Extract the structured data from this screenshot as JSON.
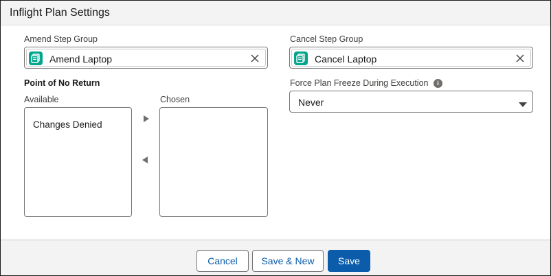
{
  "header": {
    "title": "Inflight Plan Settings"
  },
  "amend": {
    "label": "Amend Step Group",
    "value": "Amend Laptop",
    "icon": "step-group-icon",
    "clear_icon": "close-icon"
  },
  "cancel": {
    "label": "Cancel Step Group",
    "value": "Cancel Laptop",
    "icon": "step-group-icon",
    "clear_icon": "close-icon"
  },
  "point_of_no_return": {
    "title": "Point of No Return",
    "available_label": "Available",
    "chosen_label": "Chosen",
    "available_items": [
      "Changes Denied"
    ],
    "chosen_items": []
  },
  "freeze": {
    "label": "Force Plan Freeze During Execution",
    "info_icon": "info-icon",
    "value": "Never"
  },
  "footer": {
    "cancel_label": "Cancel",
    "save_new_label": "Save & New",
    "save_label": "Save"
  },
  "colors": {
    "brand": "#0b5cab",
    "icon_teal": "#04a58d",
    "header_bg": "#f3f3f3"
  }
}
